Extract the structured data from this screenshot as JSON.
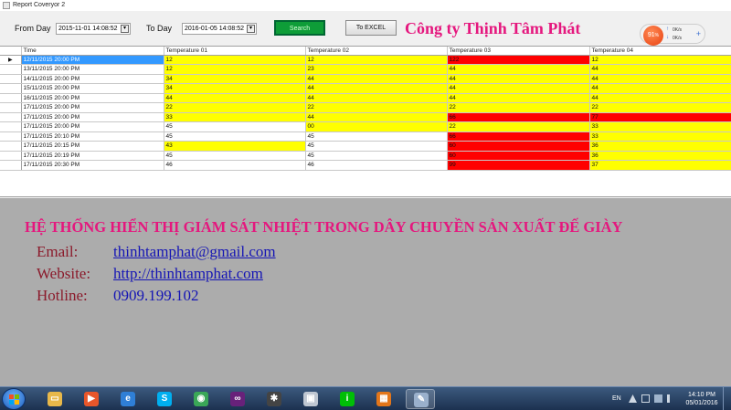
{
  "window": {
    "title": "Report Coveryor 2"
  },
  "toolbar": {
    "from_label": "From Day",
    "from_value": "2015-11-01 14:08:52",
    "to_label": "To Day",
    "to_value": "2016-01-05 14:08:52",
    "search_label": "Search",
    "excel_label": "To EXCEL",
    "company": "Công ty Thịnh Tâm Phát"
  },
  "net_widget": {
    "percent": "91",
    "percent_sign": "%",
    "up_rate": "0K/s",
    "down_rate": "0K/s",
    "plus": "+"
  },
  "grid": {
    "columns": [
      "Time",
      "Temperature 01",
      "Temperature 02",
      "Temperature 03",
      "Temperature 04"
    ],
    "current_row_marker": "▶",
    "rows": [
      {
        "time": "12/11/2015 20:00 PM",
        "cells": [
          {
            "v": "12",
            "c": "yellow"
          },
          {
            "v": "12",
            "c": "yellow"
          },
          {
            "v": "122",
            "c": "red"
          },
          {
            "v": "12",
            "c": "yellow"
          }
        ]
      },
      {
        "time": "13/11/2015 20:00 PM",
        "cells": [
          {
            "v": "12",
            "c": "yellow"
          },
          {
            "v": "23",
            "c": "yellow"
          },
          {
            "v": "44",
            "c": "yellow"
          },
          {
            "v": "44",
            "c": "yellow"
          }
        ]
      },
      {
        "time": "14/11/2015 20:00 PM",
        "cells": [
          {
            "v": "34",
            "c": "yellow"
          },
          {
            "v": "44",
            "c": "yellow"
          },
          {
            "v": "44",
            "c": "yellow"
          },
          {
            "v": "44",
            "c": "yellow"
          }
        ]
      },
      {
        "time": "15/11/2015 20:00 PM",
        "cells": [
          {
            "v": "34",
            "c": "yellow"
          },
          {
            "v": "44",
            "c": "yellow"
          },
          {
            "v": "44",
            "c": "yellow"
          },
          {
            "v": "44",
            "c": "yellow"
          }
        ]
      },
      {
        "time": "16/11/2015 20:00 PM",
        "cells": [
          {
            "v": "44",
            "c": "yellow"
          },
          {
            "v": "44",
            "c": "yellow"
          },
          {
            "v": "44",
            "c": "yellow"
          },
          {
            "v": "44",
            "c": "yellow"
          }
        ]
      },
      {
        "time": "17/11/2015 20:00 PM",
        "cells": [
          {
            "v": "22",
            "c": "yellow"
          },
          {
            "v": "22",
            "c": "yellow"
          },
          {
            "v": "22",
            "c": "yellow"
          },
          {
            "v": "22",
            "c": "yellow"
          }
        ]
      },
      {
        "time": "17/11/2015 20:00 PM",
        "cells": [
          {
            "v": "33",
            "c": "yellow"
          },
          {
            "v": "44",
            "c": "yellow"
          },
          {
            "v": "66",
            "c": "red"
          },
          {
            "v": "77",
            "c": "red"
          }
        ]
      },
      {
        "time": "17/11/2015 20:00 PM",
        "cells": [
          {
            "v": "45",
            "c": "white"
          },
          {
            "v": "00",
            "c": "yellow"
          },
          {
            "v": "22",
            "c": "yellow"
          },
          {
            "v": "33",
            "c": "yellow"
          }
        ]
      },
      {
        "time": "17/11/2015 20:10 PM",
        "cells": [
          {
            "v": "45",
            "c": "white"
          },
          {
            "v": "45",
            "c": "white"
          },
          {
            "v": "66",
            "c": "red"
          },
          {
            "v": "33",
            "c": "yellow"
          }
        ]
      },
      {
        "time": "17/11/2015 20:15 PM",
        "cells": [
          {
            "v": "43",
            "c": "yellow"
          },
          {
            "v": "45",
            "c": "white"
          },
          {
            "v": "60",
            "c": "red"
          },
          {
            "v": "36",
            "c": "yellow"
          }
        ]
      },
      {
        "time": "17/11/2015 20:19 PM",
        "cells": [
          {
            "v": "45",
            "c": "white"
          },
          {
            "v": "45",
            "c": "white"
          },
          {
            "v": "60",
            "c": "red"
          },
          {
            "v": "36",
            "c": "yellow"
          }
        ]
      },
      {
        "time": "17/11/2015 20:30 PM",
        "cells": [
          {
            "v": "46",
            "c": "white"
          },
          {
            "v": "46",
            "c": "white"
          },
          {
            "v": "99",
            "c": "red"
          },
          {
            "v": "37",
            "c": "yellow"
          }
        ]
      }
    ]
  },
  "info": {
    "headline": "HỆ THỐNG HIỂN THỊ GIÁM SÁT NHIỆT TRONG DÂY CHUYỀN SẢN XUẤT ĐẾ GIÀY",
    "email_label": "Email:",
    "email_value": "thinhtamphat@gmail.com",
    "website_label": "Website:",
    "website_value": "http://thinhtamphat.com",
    "hotline_label": "Hotline:",
    "hotline_value": "0909.199.102"
  },
  "taskbar": {
    "apps": [
      {
        "name": "file-explorer-icon",
        "color": "#e8b84a",
        "glyph": "▭"
      },
      {
        "name": "media-player-icon",
        "color": "#e8562a",
        "glyph": "▶"
      },
      {
        "name": "internet-explorer-icon",
        "color": "#2f7fd6",
        "glyph": "e"
      },
      {
        "name": "skype-icon",
        "color": "#00aff0",
        "glyph": "S"
      },
      {
        "name": "chrome-icon",
        "color": "#3aa757",
        "glyph": "◉"
      },
      {
        "name": "visual-studio-icon",
        "color": "#68217a",
        "glyph": "∞"
      },
      {
        "name": "bluetooth-app-icon",
        "color": "#444",
        "glyph": "✱"
      },
      {
        "name": "window-app-icon",
        "color": "#bfc7d2",
        "glyph": "▣"
      },
      {
        "name": "qiyi-icon",
        "color": "#00be06",
        "glyph": "i"
      },
      {
        "name": "office-icon",
        "color": "#e3761a",
        "glyph": "▦"
      },
      {
        "name": "tool-icon",
        "color": "#9ab0cc",
        "glyph": "✎"
      }
    ],
    "active_index": 10,
    "language": "EN",
    "time": "14:10 PM",
    "date": "05/01/2016"
  },
  "colors": {
    "yellow": "#ffff00",
    "red": "#ff0000",
    "brand_pink": "#e5177e",
    "link_blue": "#1515b5",
    "label_maroon": "#8b1a2b"
  }
}
